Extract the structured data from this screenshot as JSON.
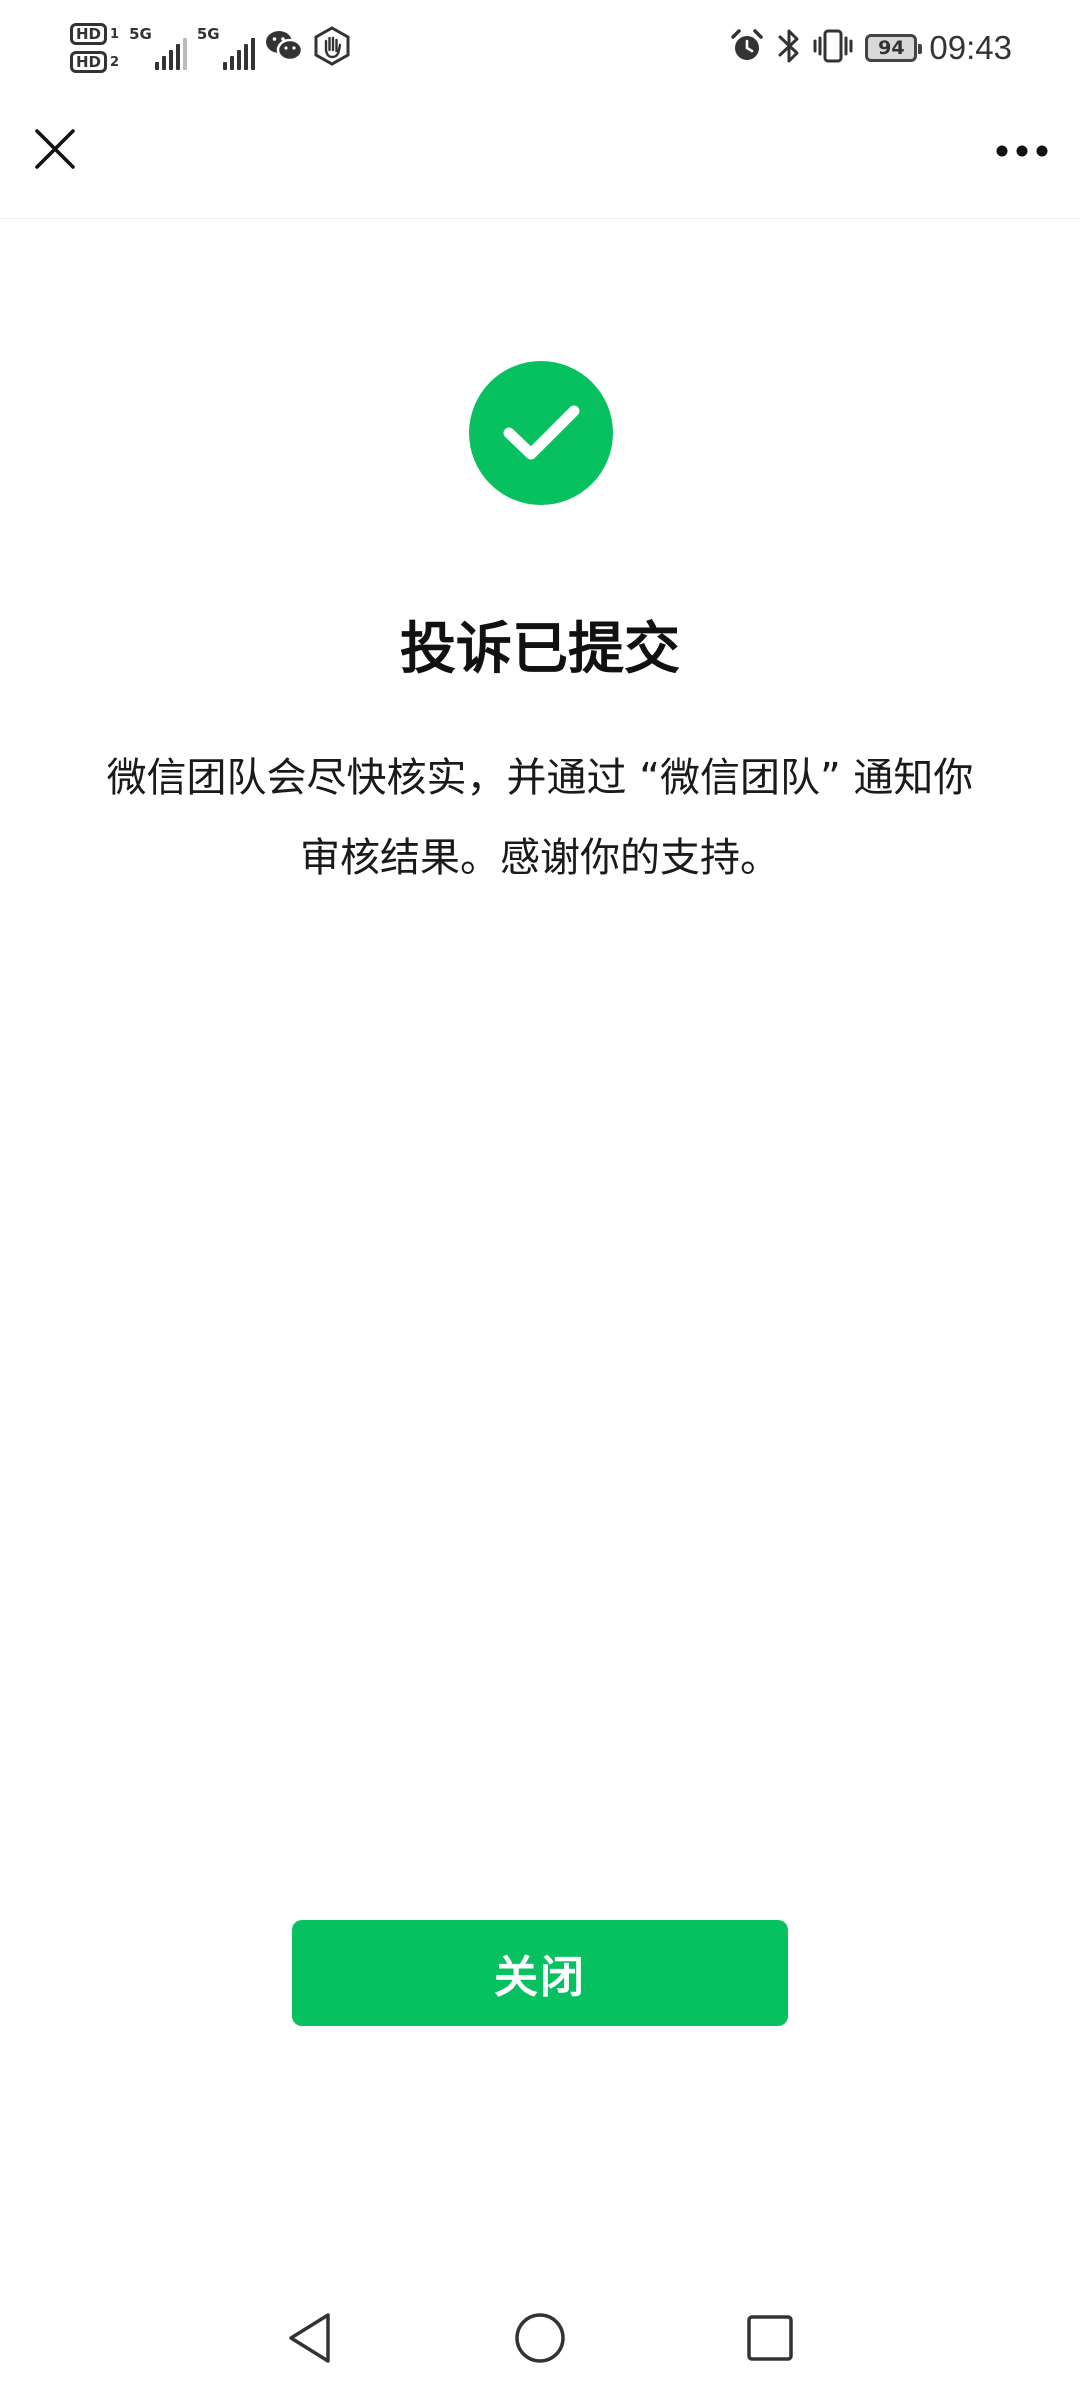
{
  "status_bar": {
    "time": "09:43",
    "battery_level": "94",
    "sim1_label": "HD",
    "sim1_num": "1",
    "sim2_label": "HD",
    "sim2_num": "2",
    "network1": "5G",
    "network2": "5G",
    "icons_left": [
      "hd-icon",
      "signal-icon",
      "signal-icon",
      "wechat-icon",
      "hand-icon"
    ],
    "icons_right": [
      "alarm-icon",
      "bluetooth-icon",
      "vibrate-icon",
      "battery-icon"
    ]
  },
  "nav": {
    "close_icon": "close-icon",
    "more_icon": "more-icon"
  },
  "content": {
    "success_icon": "check-circle-icon",
    "title": "投诉已提交",
    "description": "微信团队会尽快核实，并通过 “微信团队” 通知你审核结果。感谢你的支持。",
    "button_label": "关闭"
  },
  "system_nav": {
    "icons": [
      "back-icon",
      "home-icon",
      "recents-icon"
    ]
  },
  "colors": {
    "accent": "#07c160",
    "text": "#111111",
    "background": "#ffffff"
  }
}
